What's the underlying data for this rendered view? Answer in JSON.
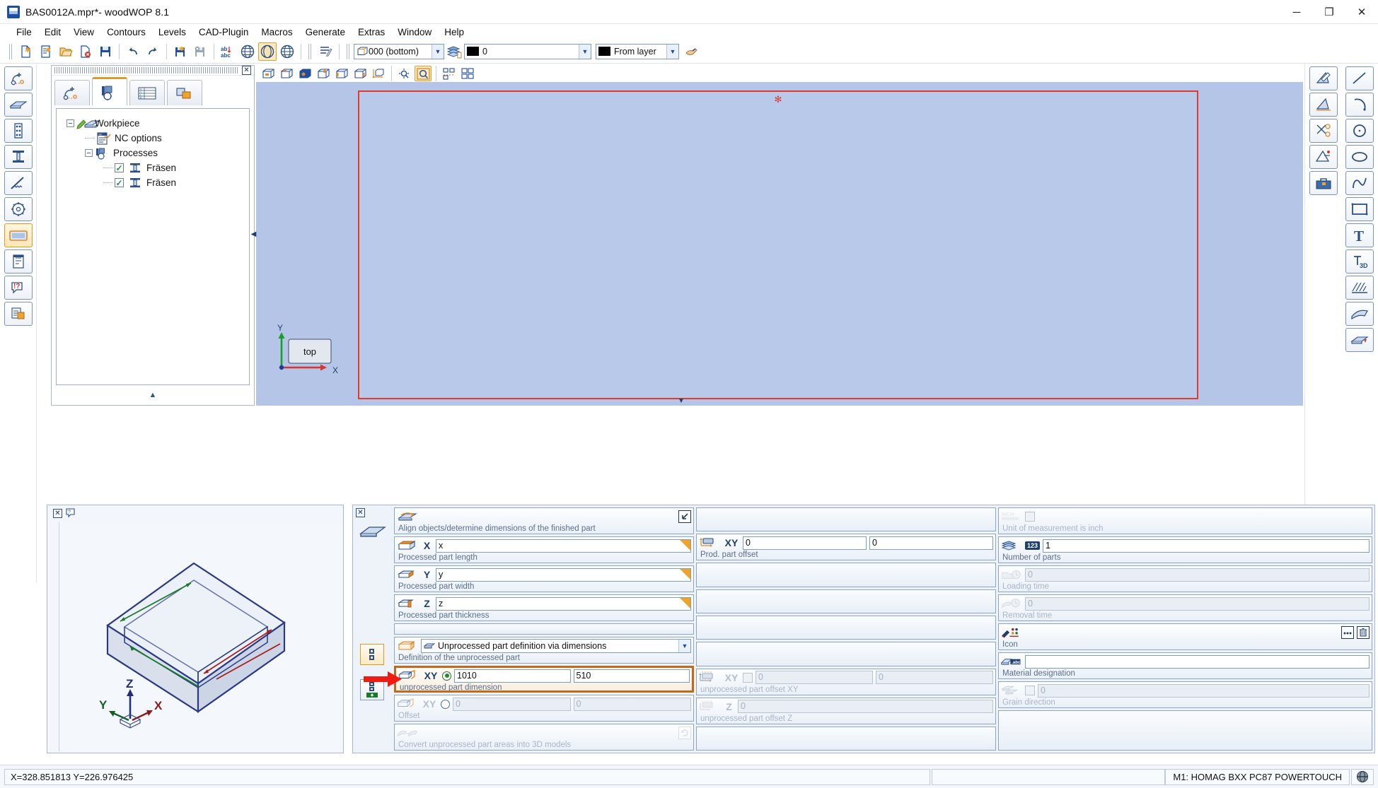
{
  "window": {
    "title": "BAS0012A.mpr*- woodWOP 8.1",
    "app_icon": "woodwop-app-icon",
    "minimize": "─",
    "maximize": "❐",
    "close": "✕"
  },
  "menu": {
    "items": [
      "File",
      "Edit",
      "View",
      "Contours",
      "Levels",
      "CAD-Plugin",
      "Macros",
      "Generate",
      "Extras",
      "Window",
      "Help"
    ]
  },
  "toolbar": {
    "buttons": [
      {
        "name": "new-document-button",
        "icon": "new-file-icon"
      },
      {
        "name": "new-from-template-button",
        "icon": "new-file-star-icon"
      },
      {
        "name": "open-file-button",
        "icon": "open-folder-icon"
      },
      {
        "name": "close-file-button",
        "icon": "file-close-icon"
      },
      {
        "name": "save-button",
        "icon": "floppy-save-icon"
      },
      {
        "name": "undo-button",
        "icon": "undo-arrow-icon"
      },
      {
        "name": "redo-button",
        "icon": "redo-arrow-icon"
      },
      {
        "name": "import-button",
        "icon": "import-file-icon"
      },
      {
        "name": "delete-file-button",
        "icon": "file-delete-icon"
      },
      {
        "name": "text-translate-button",
        "icon": "ab-abc-icon"
      },
      {
        "name": "view-global-button",
        "icon": "globe-wire-icon"
      },
      {
        "name": "view-shaded-button",
        "icon": "globe-shaded-icon"
      },
      {
        "name": "view-global-alt-button",
        "icon": "globe-wire-alt-icon"
      },
      {
        "name": "nc-program-button",
        "icon": "nc-listing-icon"
      }
    ],
    "side_combo": {
      "value": "000  (bottom)",
      "icon": "cube-side-icon"
    },
    "layers_button": {
      "icon": "layers-stack-icon"
    },
    "color_combo": {
      "value": "0",
      "swatch": "#000000"
    },
    "layer_combo": {
      "value": "From layer",
      "swatch": "#000000"
    },
    "pick_button": {
      "icon": "hand-pointer-icon"
    }
  },
  "left_rail": {
    "buttons": [
      {
        "name": "rail-contour-button",
        "icon": "contour-point-icon",
        "selected": false
      },
      {
        "name": "rail-plate-button",
        "icon": "plate-icon",
        "selected": false
      },
      {
        "name": "rail-drill-button",
        "icon": "drill-pattern-icon",
        "selected": false
      },
      {
        "name": "rail-mill-button",
        "icon": "mill-tool-icon",
        "selected": false
      },
      {
        "name": "rail-saw-button",
        "icon": "saw-cut-icon",
        "selected": false
      },
      {
        "name": "rail-sawblade-button",
        "icon": "sawblade-icon",
        "selected": false
      },
      {
        "name": "rail-workpiece-button",
        "icon": "workpiece-icon",
        "selected": true
      },
      {
        "name": "rail-list-button",
        "icon": "list-form-icon",
        "selected": false
      },
      {
        "name": "rail-help-button",
        "icon": "speech-question-icon",
        "selected": false
      },
      {
        "name": "rail-macro-button",
        "icon": "macro-stack-icon",
        "selected": false
      }
    ]
  },
  "right_rail_1": {
    "buttons": [
      {
        "name": "measure-angle-button",
        "icon": "measure-angle-icon"
      },
      {
        "name": "measure-distance-button",
        "icon": "measure-distance-icon"
      },
      {
        "name": "trim-button",
        "icon": "scissors-trim-icon"
      },
      {
        "name": "dimension-button",
        "icon": "dimension-icon"
      },
      {
        "name": "toolbox-button",
        "icon": "toolbox-icon"
      }
    ]
  },
  "right_rail_2": {
    "buttons": [
      {
        "name": "draw-line-button",
        "icon": "line-icon"
      },
      {
        "name": "draw-arc-button",
        "icon": "arc-icon"
      },
      {
        "name": "draw-circle-button",
        "icon": "circle-icon"
      },
      {
        "name": "draw-ellipse-button",
        "icon": "ellipse-icon"
      },
      {
        "name": "draw-spline-button",
        "icon": "spline-icon"
      },
      {
        "name": "draw-rectangle-button",
        "icon": "rectangle-icon"
      },
      {
        "name": "draw-text-button",
        "icon": "text-t-icon"
      },
      {
        "name": "draw-text-3d-button",
        "icon": "text-3d-icon"
      },
      {
        "name": "hatch-button",
        "icon": "hatch-icon"
      },
      {
        "name": "surface-button",
        "icon": "surface-icon"
      },
      {
        "name": "pocket-button",
        "icon": "pocket-icon"
      }
    ]
  },
  "tree_panel": {
    "close_label": "✕",
    "tabs": [
      {
        "name": "tab-contours",
        "icon": "contour-tab-icon",
        "active": false
      },
      {
        "name": "tab-processes",
        "icon": "processes-tab-icon",
        "active": true
      },
      {
        "name": "tab-variables",
        "icon": "variables-table-tab-icon",
        "active": false
      },
      {
        "name": "tab-components",
        "icon": "components-tab-icon",
        "active": false
      }
    ],
    "nodes": [
      {
        "label": "Workpiece",
        "icon": "workpiece-pencil-icon",
        "depth": 0,
        "expander": "−",
        "checkbox": null
      },
      {
        "label": "NC options",
        "icon": "nc-options-icon",
        "depth": 1,
        "expander": null,
        "checkbox": null
      },
      {
        "label": "Processes",
        "icon": "processes-icon",
        "depth": 1,
        "expander": "−",
        "checkbox": null
      },
      {
        "label": "Fräsen",
        "icon": "milling-icon",
        "depth": 2,
        "expander": null,
        "checkbox": true
      },
      {
        "label": "Fräsen",
        "icon": "milling-icon",
        "depth": 2,
        "expander": null,
        "checkbox": true
      }
    ],
    "collapse_handle": "▲"
  },
  "view_toolbar": {
    "buttons": [
      {
        "name": "view-wireframe-button",
        "icon": "cube-wire-icon",
        "active": false
      },
      {
        "name": "view-front-button",
        "icon": "cube-front-icon",
        "active": false
      },
      {
        "name": "view-solid-button",
        "icon": "cube-solid-icon",
        "active": false
      },
      {
        "name": "view-top-button",
        "icon": "cube-top-icon",
        "active": false
      },
      {
        "name": "view-side-button",
        "icon": "cube-side2-icon",
        "active": false
      },
      {
        "name": "view-iso-button",
        "icon": "cube-iso-icon",
        "active": false
      },
      {
        "name": "view-dimension-button",
        "icon": "cube-dimension-icon",
        "active": false
      },
      {
        "name": "zoom-pan-button",
        "icon": "zoom-pan-icon",
        "active": false
      },
      {
        "name": "zoom-fit-button",
        "icon": "zoom-fit-icon",
        "active": true
      },
      {
        "name": "grid-toggle-button",
        "icon": "grid-small-icon",
        "active": false
      },
      {
        "name": "grid-large-button",
        "icon": "grid-large-icon",
        "active": false
      }
    ]
  },
  "canvas": {
    "origin_marker": "✻",
    "axis_x_label": "X",
    "axis_y_label": "Y",
    "face_label": "top",
    "collapse_left": "◀",
    "collapse_bottom": "▼",
    "workpiece_outline_color": "#e03a2f",
    "background_color": "#b4c5e8"
  },
  "preview_panel": {
    "close_label": "✕",
    "help_icon": "preview-question-icon",
    "axes": {
      "x": "X",
      "y": "Y",
      "z": "Z"
    }
  },
  "param_panel": {
    "close_label": "✕",
    "header_icon": "workpiece-header-icon",
    "gutter_buttons": [
      {
        "name": "gutter-detail-button",
        "icon": "two-squares-icon",
        "selected": true
      },
      {
        "name": "gutter-add-button",
        "icon": "two-squares-plus-icon",
        "selected": false
      }
    ],
    "column1": [
      {
        "name": "align-objects-field",
        "label": "Align objects/determine dimensions of the finished part",
        "icon": "align-objects-icon",
        "type": "header",
        "button_icon": "arrow-pick-icon",
        "disabled": false
      },
      {
        "name": "processed-part-length-field",
        "label": "Processed part length",
        "icon": "part-length-icon",
        "axis": "X",
        "value": "x",
        "type": "text-fx",
        "disabled": false
      },
      {
        "name": "processed-part-width-field",
        "label": "Processed part width",
        "icon": "part-width-icon",
        "axis": "Y",
        "value": "y",
        "type": "text-fx",
        "disabled": false
      },
      {
        "name": "processed-part-thickness-field",
        "label": "Processed part thickness",
        "icon": "part-thickness-icon",
        "axis": "Z",
        "value": "z",
        "type": "text-fx",
        "disabled": false
      },
      {
        "name": "spacer-field-1",
        "label": "",
        "type": "blank"
      },
      {
        "name": "unprocessed-part-definition-field",
        "label": "Definition of the unprocessed part",
        "icon": "unprocessed-part-icon",
        "value": "Unprocessed part definition via dimensions",
        "type": "combo",
        "button_icon": "arrow-pick-icon",
        "disabled": false
      },
      {
        "name": "unprocessed-part-dimension-field",
        "label": "unprocessed part dimension",
        "icon": "unprocessed-dim-icon",
        "axis": "XY",
        "value1": "1010",
        "value2": "510",
        "type": "dual-radio",
        "radio_on": true,
        "highlighted": true,
        "disabled": false
      },
      {
        "name": "offset-field",
        "label": "Offset",
        "icon": "offset-icon",
        "axis": "XY",
        "value1": "0",
        "value2": "0",
        "type": "dual-radio",
        "radio_on": false,
        "disabled": true
      },
      {
        "name": "convert-3d-field",
        "label": "Convert unprocessed part areas into 3D models",
        "icon": "convert-3d-icon",
        "type": "header",
        "button_icon": "convert-button-icon",
        "disabled": true
      }
    ],
    "column2": [
      {
        "name": "col2-spacer-1",
        "label": "",
        "type": "blank"
      },
      {
        "name": "prod-part-offset-field",
        "label": "Prod. part offset",
        "icon": "part-offset-icon",
        "axis": "XY",
        "value1": "0",
        "value2": "0",
        "type": "dual",
        "disabled": false
      },
      {
        "name": "col2-spacer-2",
        "label": "",
        "type": "blank"
      },
      {
        "name": "col2-spacer-3",
        "label": "",
        "type": "blank"
      },
      {
        "name": "col2-spacer-4",
        "label": "",
        "type": "blank"
      },
      {
        "name": "col2-spacer-5",
        "label": "",
        "type": "blank"
      },
      {
        "name": "unprocessed-part-offset-xy-field",
        "label": "unprocessed part offset XY",
        "icon": "unproc-offset-xy-icon",
        "axis": "XY",
        "value1": "0",
        "value2": "0",
        "type": "dual-check",
        "checked": false,
        "disabled": true
      },
      {
        "name": "unprocessed-part-offset-z-field",
        "label": "unprocessed part offset Z",
        "icon": "unproc-offset-z-icon",
        "axis": "Z",
        "value": "0",
        "type": "text",
        "disabled": true
      },
      {
        "name": "col2-spacer-6",
        "label": "",
        "type": "blank"
      }
    ],
    "column3": [
      {
        "name": "unit-inch-field",
        "label": "Unit of measurement is inch",
        "icon": "inch-ruler-icon",
        "type": "checkbox",
        "checked": false,
        "disabled": true
      },
      {
        "name": "number-of-parts-field",
        "label": "Number of parts",
        "icon": "parts-stack-icon",
        "badge": "123",
        "value": "1",
        "type": "text",
        "disabled": false
      },
      {
        "name": "loading-time-field",
        "label": "Loading time",
        "icon": "loading-time-icon",
        "value": "0",
        "type": "text",
        "disabled": true
      },
      {
        "name": "removal-time-field",
        "label": "Removal time",
        "icon": "removal-time-icon",
        "value": "0",
        "type": "text",
        "disabled": true
      },
      {
        "name": "icon-field",
        "label": "Icon",
        "icon": "palette-brush-icon",
        "type": "icon-pick",
        "btn1_icon": "ellipsis-icon",
        "btn1_label": "…",
        "btn2_icon": "trash-icon",
        "disabled": false
      },
      {
        "name": "material-designation-field",
        "label": "Material designation",
        "icon": "material-abc-icon",
        "value": "",
        "type": "text",
        "disabled": false
      },
      {
        "name": "grain-direction-field",
        "label": "Grain direction",
        "icon": "grain-direction-icon",
        "value": "0",
        "type": "check-text",
        "checked": false,
        "disabled": true
      },
      {
        "name": "col3-spacer-1",
        "label": "",
        "type": "blank"
      }
    ]
  },
  "statusbar": {
    "coordinates": "X=328.851813 Y=226.976425",
    "machine": "M1: HOMAG BXX PC87 POWERTOUCH",
    "machine_icon": "machine-status-icon"
  }
}
